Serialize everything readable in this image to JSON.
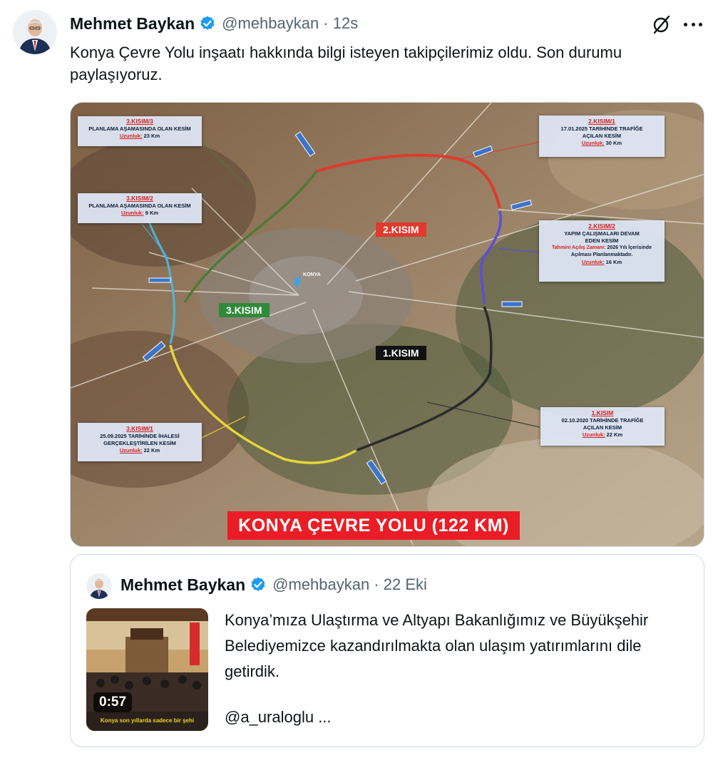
{
  "tweet": {
    "author_name": "Mehmet Baykan",
    "handle_time": "@mehbaykan · 12s",
    "text": "Konya Çevre Yolu inşaatı hakkında bilgi isteyen takipçilerimiz oldu. Son durumu paylaşıyoruz.",
    "icons": [
      "grok-icon",
      "more-icon",
      "verified-badge-icon"
    ]
  },
  "map": {
    "banner": "KONYA ÇEVRE YOLU (122 KM)",
    "city": "KONYA",
    "tags": {
      "k1": "1.KISIM",
      "k2": "2.KISIM",
      "k3": "3.KISIM"
    },
    "labels": {
      "k3_3": {
        "title": "3.KISIM/3",
        "body": "PLANLAMA AŞAMASINDA OLAN KESİM",
        "length_key": "Uzunluk:",
        "length_val": "23 Km"
      },
      "k3_2": {
        "title": "3.KISIM/2",
        "body": "PLANLAMA AŞAMASINDA OLAN KESİM",
        "length_key": "Uzunluk:",
        "length_val": "9 Km"
      },
      "k2_1": {
        "title": "2.KISIM/1",
        "body": "17.01.2025 TARİHİNDE TRAFİĞE AÇILAN KESİM",
        "length_key": "Uzunluk:",
        "length_val": "30 Km"
      },
      "k2_2": {
        "title": "2.KISIM/2",
        "body": "YAPIM ÇALIŞMALARI DEVAM EDEN KESİM",
        "date_key": "Tahmini Açılış Zamanı:",
        "date_val": "2026 Yılı İçerisinde Açılması Planlanmaktadır.",
        "length_key": "Uzunluk:",
        "length_val": "16 Km"
      },
      "k1": {
        "title": "1.KISIM",
        "body": "02.10.2020 TARİHİNDE TRAFİĞE AÇILAN KESİM",
        "length_key": "Uzunluk:",
        "length_val": "22 Km"
      },
      "k3_1": {
        "title": "3.KISIM/1",
        "body": "25.09.2025 TARİHİNDE İHALESİ GERÇEKLEŞTİRİLEN KESİM",
        "length_key": "Uzunluk:",
        "length_val": "22 Km"
      }
    },
    "colors": {
      "k1": "#2b2b2b",
      "k2_1": "#e0392e",
      "k2_2": "#5a4fd8",
      "k3_1": "#e3d63a",
      "k3_2": "#4db6d6",
      "k3_3": "#4f7a36"
    }
  },
  "quote": {
    "author_name": "Mehmet Baykan",
    "handle_time": "@mehbaykan · 22 Eki",
    "text": "Konya’mıza Ulaştırma ve Altyapı Bakanlığımız ve Büyükşehir Belediyemizce kazandırılmakta olan ulaşım yatırımlarını dile getirdik.",
    "mention": "@a_uraloglu ...",
    "video_duration": "0:57",
    "video_subtitle": "Konya son yıllarda sadece bir şehi"
  }
}
